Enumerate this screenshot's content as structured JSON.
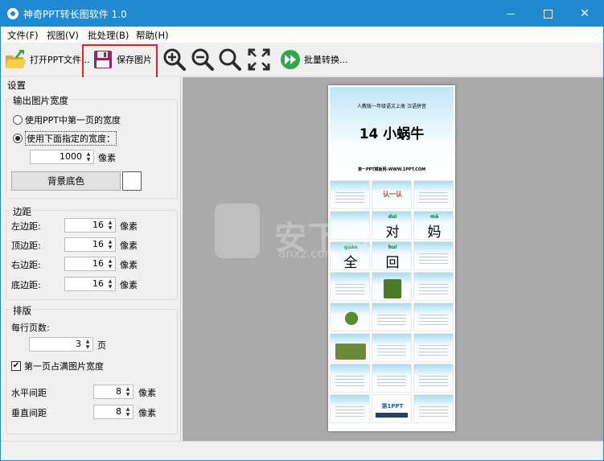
{
  "window": {
    "title": "神奇PPT转长图软件 1.0"
  },
  "menu": [
    {
      "label": "文件(F)"
    },
    {
      "label": "视图(V)"
    },
    {
      "label": "批处理(B)"
    },
    {
      "label": "帮助(H)"
    }
  ],
  "toolbar": {
    "open_label": "打开PPT文件...",
    "save_label": "保存图片",
    "batch_label": "批量转换..."
  },
  "settings": {
    "title": "设置",
    "width_group": {
      "title": "输出图片宽度",
      "option_first": "使用PPT中第一页的宽度",
      "option_custom": "使用下面指定的宽度：",
      "width_value": "1000",
      "unit": "像素",
      "bg_button": "背景底色",
      "bg_color": "#ffffff"
    },
    "margin_group": {
      "title": "边距",
      "rows": [
        {
          "label": "左边距:",
          "value": "16",
          "unit": "像素"
        },
        {
          "label": "顶边距:",
          "value": "16",
          "unit": "像素"
        },
        {
          "label": "右边距:",
          "value": "16",
          "unit": "像素"
        },
        {
          "label": "底边距:",
          "value": "16",
          "unit": "像素"
        }
      ]
    },
    "layout_group": {
      "title": "排版",
      "per_row_label": "每行页数:",
      "per_row_value": "3",
      "per_row_unit": "页",
      "first_full_label": "第一页占满图片宽度",
      "h_spacing_label": "水平间距",
      "h_spacing_value": "8",
      "h_spacing_unit": "像素",
      "v_spacing_label": "垂直间距",
      "v_spacing_value": "8",
      "v_spacing_unit": "像素"
    }
  },
  "preview": {
    "slide1_top": "人教版一年级语文上册   汉语拼音",
    "slide1_title": "14 小蜗牛",
    "slide1_foot": "第一PPT模板网-WWW.1PPT.COM",
    "chars": [
      {
        "pinyin": "duì",
        "char": "对"
      },
      {
        "pinyin": "mā",
        "char": "妈"
      },
      {
        "pinyin": "quán",
        "char": "全"
      },
      {
        "pinyin": "huí",
        "char": "回"
      }
    ],
    "thumb_label": "认一认",
    "last_logo": "第1PPT",
    "watermark": "安下载",
    "watermark_sub": "anxz.com"
  }
}
